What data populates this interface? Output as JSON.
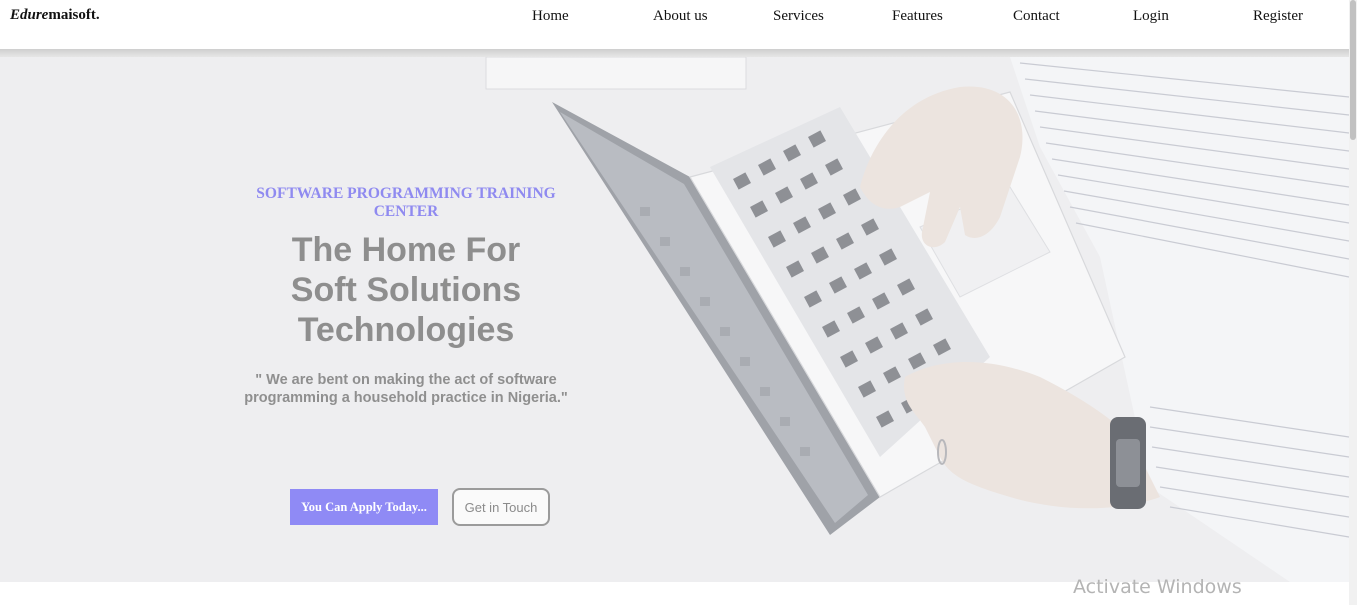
{
  "nav": {
    "brand_italic": "Edure",
    "brand_rest": "maisoft.",
    "links": [
      "Home",
      "About us",
      "Services",
      "Features",
      "Contact",
      "Login",
      "Register"
    ]
  },
  "hero": {
    "eyebrow": "SOFTWARE PROGRAMMING TRAINING CENTER",
    "headline": "The Home For Soft Solutions Technologies",
    "quote": "\" We are bent on making the act of software programming a household practice in Nigeria.\"",
    "apply_button": "You Can Apply Today...",
    "touch_button": "Get in Touch"
  },
  "overlay": {
    "watermark": "Activate Windows"
  },
  "colors": {
    "accent": "#8f8af5",
    "headline": "#8e8e8e",
    "hero_bg": "#eeeef0"
  }
}
